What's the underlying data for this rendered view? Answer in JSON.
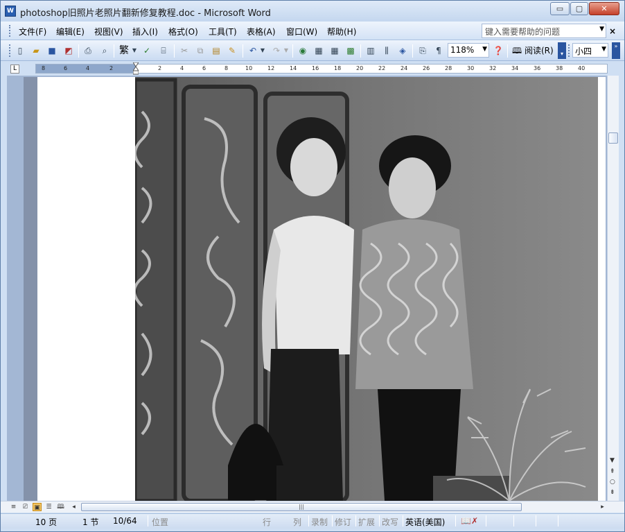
{
  "window": {
    "title": "photoshop旧照片老照片翻新修复教程.doc - Microsoft Word",
    "app_icon": "word-doc-icon",
    "minimize": "▭",
    "maximize": "▢",
    "close": "✕"
  },
  "menu": {
    "items": [
      {
        "label": "文件(F)"
      },
      {
        "label": "编辑(E)"
      },
      {
        "label": "视图(V)"
      },
      {
        "label": "插入(I)"
      },
      {
        "label": "格式(O)"
      },
      {
        "label": "工具(T)"
      },
      {
        "label": "表格(A)"
      },
      {
        "label": "窗口(W)"
      },
      {
        "label": "帮助(H)"
      }
    ],
    "help_placeholder": "键入需要帮助的问题",
    "help_close": "×"
  },
  "toolbar": {
    "trad_label": "繁",
    "zoom_value": "118%",
    "read_label": "阅读(R)",
    "font_size": "小四"
  },
  "ruler": {
    "corner": "L",
    "labels": [
      "8",
      "6",
      "4",
      "2",
      "2",
      "4",
      "6",
      "8",
      "10",
      "12",
      "14",
      "16",
      "18",
      "20",
      "22",
      "24",
      "26",
      "28",
      "30",
      "32",
      "34",
      "36",
      "38",
      "40"
    ]
  },
  "status": {
    "page": "10 页",
    "section": "1 节",
    "page_of": "10/64",
    "position": "位置",
    "line": "行",
    "column": "列",
    "record": "录制",
    "revise": "修订",
    "extend": "扩展",
    "overwrite": "改写",
    "language": "英语(美国)"
  }
}
